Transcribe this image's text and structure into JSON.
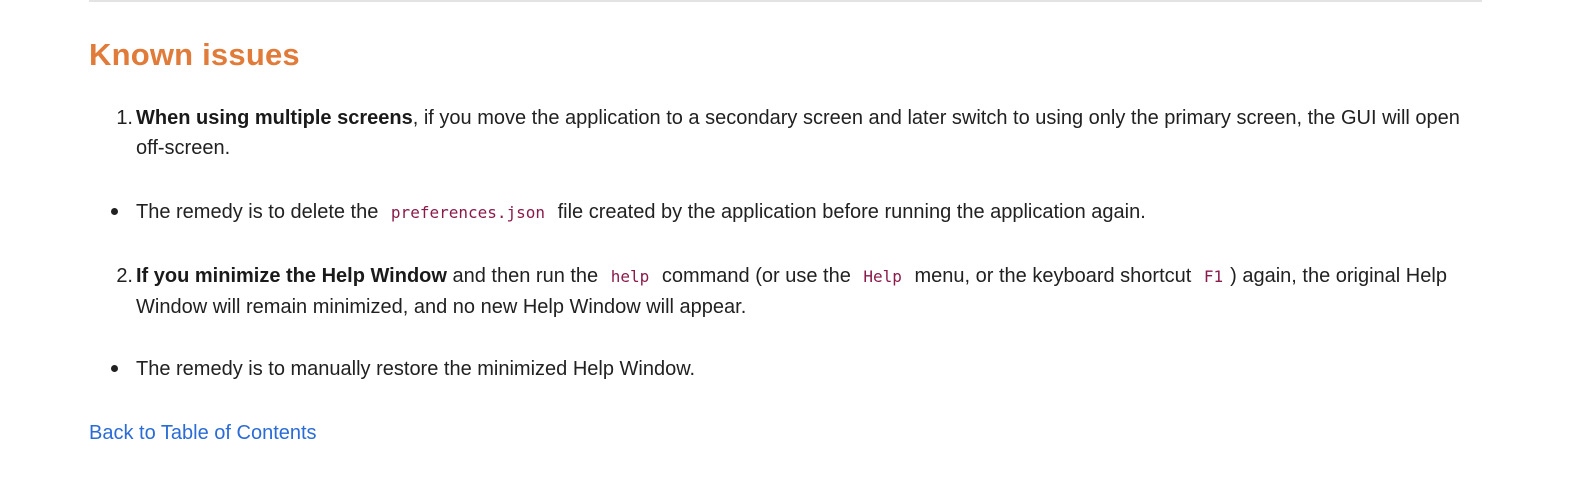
{
  "section": {
    "title": "Known issues"
  },
  "issues": [
    {
      "number": "1.",
      "bold": "When using multiple screens",
      "text": ", if you move the application to a secondary screen and later switch to using only the primary screen, the GUI will open off-screen.",
      "remedy_pre": "The remedy is to delete the",
      "remedy_code": "preferences.json",
      "remedy_post": "file created by the application before running the application again."
    },
    {
      "number": "2.",
      "bold": "If you minimize the Help Window",
      "text_a": "and then run the",
      "code_a": "help",
      "text_b": "command (or use the",
      "code_b": "Help",
      "text_c": "menu, or the keyboard shortcut",
      "code_c": "F1",
      "text_d": ") again, the original Help Window will remain minimized, and no new Help Window will appear.",
      "remedy": "The remedy is to manually restore the minimized Help Window."
    }
  ],
  "back_link": "Back to Table of Contents"
}
